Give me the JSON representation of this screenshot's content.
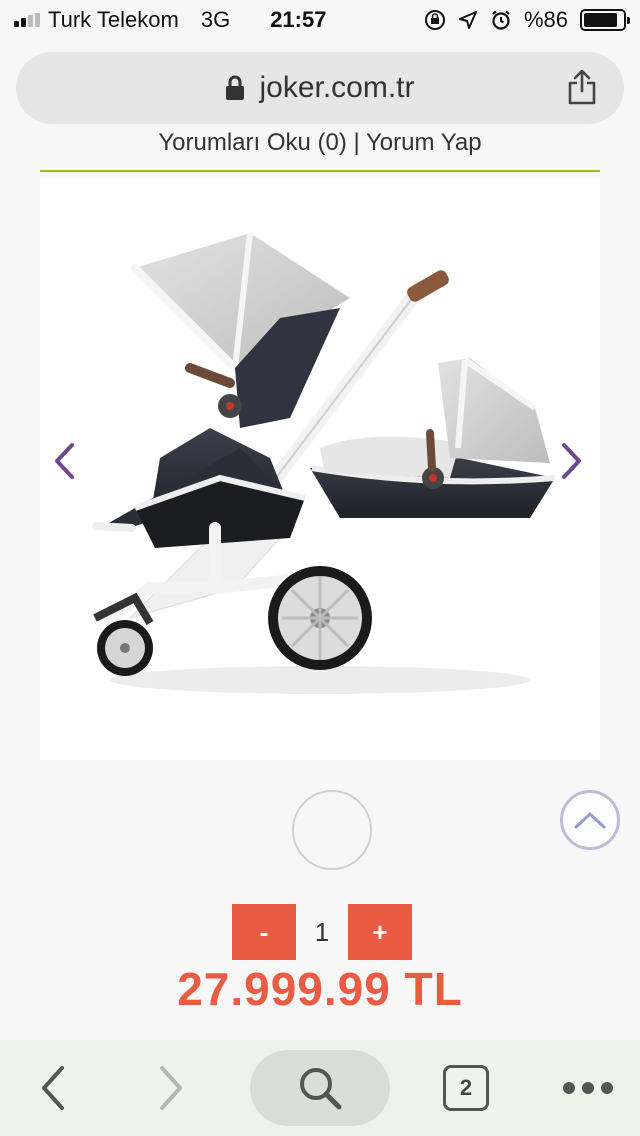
{
  "status_bar": {
    "carrier": "Turk Telekom",
    "network": "3G",
    "time": "21:57",
    "battery_text": "%86",
    "battery_level": 0.86
  },
  "browser": {
    "url": "joker.com.tr",
    "tab_count": "2"
  },
  "product": {
    "reviews_link": "Yorumları Oku (0) | Yorum Yap",
    "quantity": "1",
    "minus_label": "-",
    "plus_label": "+",
    "price": "27.999.99 TL"
  },
  "colors": {
    "accent": "#ea5b43",
    "divider": "#a9b51b",
    "carousel_arrow": "#6d4a8f"
  },
  "icons": {
    "lock": "lock-icon",
    "share": "share-icon",
    "prev": "chevron-left-icon",
    "next": "chevron-right-icon",
    "scroll_top": "chevron-up-icon",
    "back": "back-icon",
    "forward": "forward-icon",
    "search": "search-icon",
    "tabs": "tabs-icon",
    "more": "more-icon"
  }
}
